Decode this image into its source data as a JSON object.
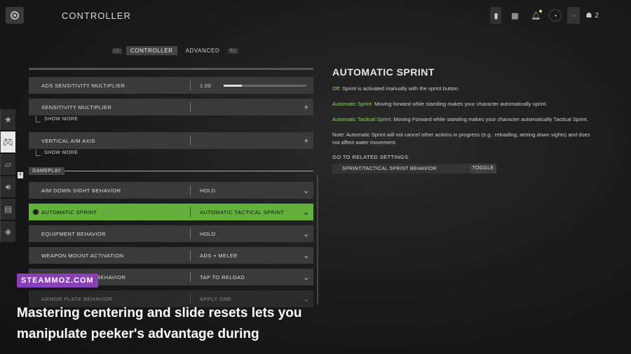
{
  "header": {
    "title": "CONTROLLER",
    "party_count": "2",
    "icons": [
      "back-icon",
      "controller-small-icon",
      "grid-icon",
      "bell-icon",
      "circle-icon",
      "box-icon",
      "party-icon"
    ]
  },
  "tabs": {
    "left_key": "L1",
    "right_key": "R1",
    "items": [
      {
        "label": "CONTROLLER",
        "active": true
      },
      {
        "label": "ADVANCED",
        "active": false
      }
    ]
  },
  "side_rail": {
    "icons": [
      "star-icon",
      "gamepad-icon",
      "display-icon",
      "speaker-icon",
      "interface-icon",
      "network-icon"
    ],
    "active_index": 1
  },
  "settings": {
    "ads_multiplier": {
      "label": "ADS SENSITIVITY MULTIPLIER",
      "value": "1.00",
      "level": 0.22
    },
    "sensitivity_multiplier": {
      "label": "SENSITIVITY MULTIPLIER",
      "show_more": "SHOW MORE"
    },
    "vertical_aim_axis": {
      "label": "VERTICAL AIM AXIS",
      "show_more": "SHOW MORE"
    },
    "section_gameplay": "GAMEPLAY",
    "gameplay_rows": [
      {
        "label": "AIM DOWN SIGHT BEHAVIOR",
        "value": "HOLD"
      },
      {
        "label": "AUTOMATIC SPRINT",
        "value": "AUTOMATIC TACTICAL SPRINT"
      },
      {
        "label": "EQUIPMENT BEHAVIOR",
        "value": "HOLD"
      },
      {
        "label": "WEAPON MOUNT ACTIVATION",
        "value": "ADS + MELEE"
      },
      {
        "label": "INTERACT/RELOAD BEHAVIOR",
        "value": "TAP TO RELOAD"
      },
      {
        "label": "ARMOR PLATE BEHAVIOR",
        "value": "APPLY ONE"
      }
    ]
  },
  "detail": {
    "title": "AUTOMATIC SPRINT",
    "off_label": "Off:",
    "off_text": " Sprint is activated manually with the sprint button.",
    "auto_label": "Automatic Sprint:",
    "auto_text": " Moving forward while standing makes your character automatically sprint.",
    "tactical_label": "Automatic Tactical Sprint:",
    "tactical_text": " Moving Forward while standing makes your character automatically Tactical Sprint.",
    "note": "Note: Automatic Sprint will not cancel other actions in progress (e.g.: reloading, aiming down sights) and does not affect water movement.",
    "related_heading": "GO TO RELATED SETTINGS",
    "related_label": "SPRINT/TACTICAL SPRINT BEHAVIOR",
    "related_value": "TOGGLE"
  },
  "overlay": {
    "watermark": "STEAMMOZ.COM",
    "caption": "Mastering centering and slide resets lets you manipulate peeker's advantage during"
  },
  "colors": {
    "accent_green": "#61b13b",
    "highlight_text": "#8fd36a",
    "watermark_bg": "#8a3fb5"
  }
}
